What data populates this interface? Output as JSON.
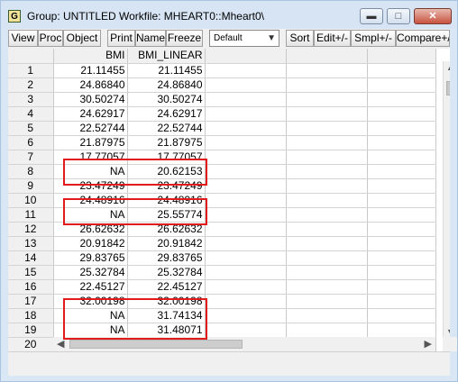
{
  "window": {
    "icon_letter": "G",
    "title": "Group: UNTITLED   Workfile: MHEART0::Mheart0\\"
  },
  "toolbar": {
    "buttons": [
      "View",
      "Proc",
      "Object",
      "Print",
      "Name",
      "Freeze"
    ],
    "select_value": "Default",
    "buttons_right": [
      "Sort",
      "Edit+/-",
      "Smpl+/-",
      "Compare+/-"
    ]
  },
  "grid": {
    "columns": [
      "BMI",
      "BMI_LINEAR"
    ],
    "rows": [
      {
        "n": "1",
        "bmi": "21.11455",
        "lin": "21.11455"
      },
      {
        "n": "2",
        "bmi": "24.86840",
        "lin": "24.86840"
      },
      {
        "n": "3",
        "bmi": "30.50274",
        "lin": "30.50274"
      },
      {
        "n": "4",
        "bmi": "24.62917",
        "lin": "24.62917"
      },
      {
        "n": "5",
        "bmi": "22.52744",
        "lin": "22.52744"
      },
      {
        "n": "6",
        "bmi": "21.87975",
        "lin": "21.87975"
      },
      {
        "n": "7",
        "bmi": "17.77057",
        "lin": "17.77057"
      },
      {
        "n": "8",
        "bmi": "NA",
        "lin": "20.62153"
      },
      {
        "n": "9",
        "bmi": "23.47249",
        "lin": "23.47249"
      },
      {
        "n": "10",
        "bmi": "24.48916",
        "lin": "24.48916"
      },
      {
        "n": "11",
        "bmi": "NA",
        "lin": "25.55774"
      },
      {
        "n": "12",
        "bmi": "26.62632",
        "lin": "26.62632"
      },
      {
        "n": "13",
        "bmi": "20.91842",
        "lin": "20.91842"
      },
      {
        "n": "14",
        "bmi": "29.83765",
        "lin": "29.83765"
      },
      {
        "n": "15",
        "bmi": "25.32784",
        "lin": "25.32784"
      },
      {
        "n": "16",
        "bmi": "22.45127",
        "lin": "22.45127"
      },
      {
        "n": "17",
        "bmi": "32.00198",
        "lin": "32.00198"
      },
      {
        "n": "18",
        "bmi": "NA",
        "lin": "31.74134"
      },
      {
        "n": "19",
        "bmi": "NA",
        "lin": "31.48071"
      },
      {
        "n": "20",
        "bmi": "",
        "lin": ""
      }
    ]
  },
  "highlight_color": "#e11b1b"
}
